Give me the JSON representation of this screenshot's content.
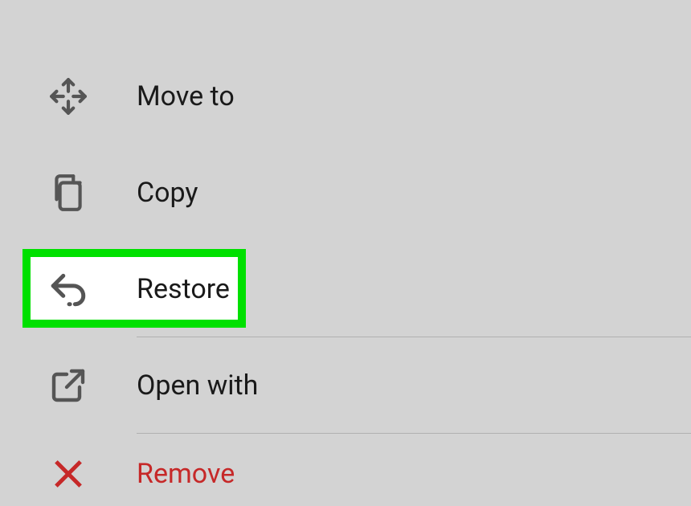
{
  "menu": {
    "items": [
      {
        "label": "Move to"
      },
      {
        "label": "Copy"
      },
      {
        "label": "Restore"
      },
      {
        "label": "Open with"
      },
      {
        "label": "Remove"
      }
    ]
  }
}
